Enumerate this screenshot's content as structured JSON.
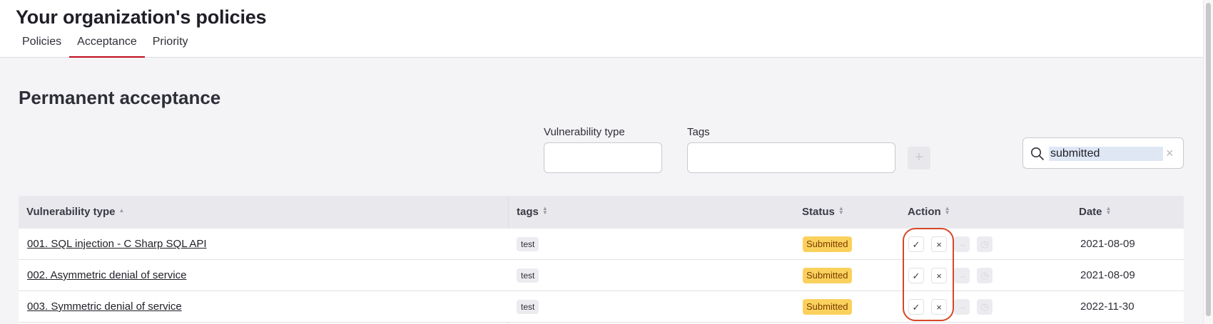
{
  "header": {
    "title": "Your organization's policies",
    "tabs": [
      {
        "label": "Policies",
        "active": false
      },
      {
        "label": "Acceptance",
        "active": true
      },
      {
        "label": "Priority",
        "active": false
      }
    ]
  },
  "section": {
    "title": "Permanent acceptance"
  },
  "filters": {
    "vulnerability_type_label": "Vulnerability type",
    "vulnerability_type_value": "",
    "tags_label": "Tags",
    "tags_value": "",
    "add_label": "+"
  },
  "search": {
    "value": "submitted",
    "clear_label": "×"
  },
  "table": {
    "columns": [
      {
        "label": "Vulnerability type",
        "sort": "ascending"
      },
      {
        "label": "tags",
        "sort": "none"
      },
      {
        "label": "Status",
        "sort": "none"
      },
      {
        "label": "Action",
        "sort": "none"
      },
      {
        "label": "Date",
        "sort": "none"
      }
    ],
    "rows": [
      {
        "vulnerability_type": "001. SQL injection - C Sharp SQL API",
        "tag": "test",
        "status": "Submitted",
        "date": "2021-08-09"
      },
      {
        "vulnerability_type": "002. Asymmetric denial of service",
        "tag": "test",
        "status": "Submitted",
        "date": "2021-08-09"
      },
      {
        "vulnerability_type": "003. Symmetric denial of service",
        "tag": "test",
        "status": "Submitted",
        "date": "2022-11-30"
      }
    ],
    "action_icons": {
      "approve": "✓",
      "reject": "×",
      "edit": "→",
      "history": "◷"
    }
  },
  "colors": {
    "accent": "#bf0b1a",
    "status_submitted": "#fbd15d",
    "highlight": "#d64626"
  }
}
